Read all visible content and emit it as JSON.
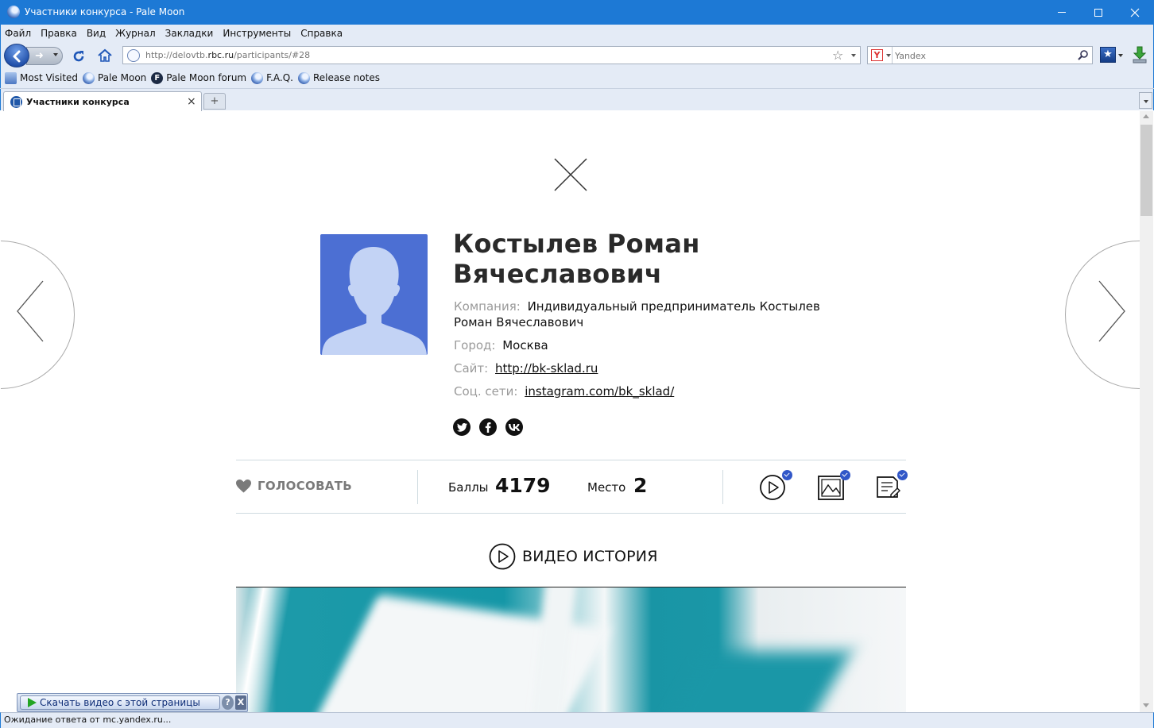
{
  "window": {
    "title": "Участники конкурса - Pale Moon",
    "accent": "#1d79d5"
  },
  "menu": {
    "items": [
      "Файл",
      "Правка",
      "Вид",
      "Журнал",
      "Закладки",
      "Инструменты",
      "Справка"
    ]
  },
  "navbar": {
    "url_prefix": "http://delovtb.",
    "url_domain": "rbc.ru",
    "url_path": "/participants/#28",
    "search_placeholder": "Yandex",
    "search_engine_letter": "Y"
  },
  "bookmarks": {
    "items": [
      "Most Visited",
      "Pale Moon",
      "Pale Moon forum",
      "F.A.Q.",
      "Release notes"
    ]
  },
  "tabs": {
    "active_label": "Участники конкурса",
    "close_symbol": "×",
    "new_tab_symbol": "+"
  },
  "participant": {
    "name": "Костылев Роман Вячеславович",
    "company_label": "Компания:",
    "company": "Индивидуальный предприниматель Костылев Роман Вячеславович",
    "city_label": "Город:",
    "city": "Москва",
    "site_label": "Сайт:",
    "site": "http://bk-sklad.ru",
    "social_label": "Соц. сети:",
    "social": "instagram.com/bk_sklad/",
    "avatar_color": "#4c6fd3"
  },
  "stats": {
    "vote_label": "ГОЛОСОВАТЬ",
    "score_label": "Баллы",
    "score": "4179",
    "place_label": "Место",
    "place": "2",
    "check_color": "#3157c8"
  },
  "section": {
    "video_title": "ВИДЕО ИСТОРИЯ"
  },
  "download_bar": {
    "label": "Скачать видео с этой страницы",
    "help": "?",
    "close": "X"
  },
  "status": {
    "text": "Ожидание ответа от mc.yandex.ru..."
  }
}
